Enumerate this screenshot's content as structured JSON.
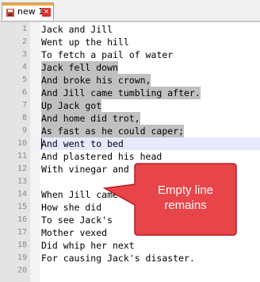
{
  "tab": {
    "label": "new 1",
    "close_glyph": "×"
  },
  "lines": [
    {
      "n": "1",
      "text": "Jack and Jill",
      "selected": false
    },
    {
      "n": "2",
      "text": "Went up the hill",
      "selected": false
    },
    {
      "n": "3",
      "text": "To fetch a pail of water",
      "selected": false
    },
    {
      "n": "4",
      "text": "Jack fell down",
      "selected": true
    },
    {
      "n": "5",
      "text": "And broke his crown,",
      "selected": true
    },
    {
      "n": "6",
      "text": "And Jill came tumbling after.",
      "selected": true
    },
    {
      "n": "7",
      "text": "Up Jack got",
      "selected": true
    },
    {
      "n": "8",
      "text": "And home did trot,",
      "selected": true
    },
    {
      "n": "9",
      "text": "As fast as he could caper;",
      "selected": true
    },
    {
      "n": "10",
      "text": "And went to bed",
      "selected": false,
      "current": true
    },
    {
      "n": "11",
      "text": "And plastered his head",
      "selected": false
    },
    {
      "n": "12",
      "text": "With vinegar and brown paper.",
      "selected": false
    },
    {
      "n": "13",
      "text": "",
      "selected": false
    },
    {
      "n": "14",
      "text": "When Jill came",
      "selected": false
    },
    {
      "n": "15",
      "text": "How she did",
      "selected": false
    },
    {
      "n": "16",
      "text": "To see Jack's",
      "selected": false
    },
    {
      "n": "17",
      "text": "Mother vexed",
      "selected": false
    },
    {
      "n": "18",
      "text": "Did whip her next",
      "selected": false
    },
    {
      "n": "19",
      "text": "For causing Jack's disaster.",
      "selected": false
    },
    {
      "n": "20",
      "text": "",
      "selected": false
    }
  ],
  "callout": {
    "line1": "Empty line",
    "line2": "remains"
  },
  "colors": {
    "tab_accent": "#f7a437",
    "selection": "#c0c0c0",
    "current_line": "#e8e8ff",
    "callout_fill": "#e8454a",
    "callout_stroke": "#b31e23",
    "gutter": "#e4e4e4"
  },
  "icons": {
    "tab": "floppy-disk-icon",
    "close": "close-icon"
  }
}
